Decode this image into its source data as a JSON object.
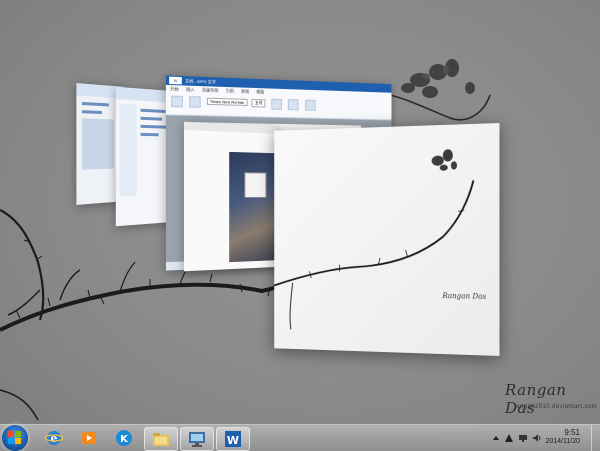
{
  "desktop": {
    "signature": "Rangan Das",
    "signature_url": "rangan2510.deviantart.com"
  },
  "windows": {
    "writer_title": "文档 - WPS 文字",
    "writer_tabs": [
      "开始",
      "插入",
      "页面布局",
      "引用",
      "审阅",
      "视图"
    ],
    "writer_font": "Times New Roman",
    "writer_size": "五号"
  },
  "taskbar": {
    "time": "9:51",
    "date": "2014/11/20",
    "pinned": [
      {
        "name": "ie-icon"
      },
      {
        "name": "media-player-icon"
      },
      {
        "name": "kugou-icon"
      },
      {
        "name": "file-explorer-icon"
      },
      {
        "name": "remote-desktop-icon"
      },
      {
        "name": "wps-writer-icon"
      }
    ]
  },
  "colors": {
    "desktop_bg": "#8a8a8a",
    "taskbar": "#9a9a9a",
    "titlebar": "#1f5fb0",
    "start_orb": "#1d5fae"
  }
}
